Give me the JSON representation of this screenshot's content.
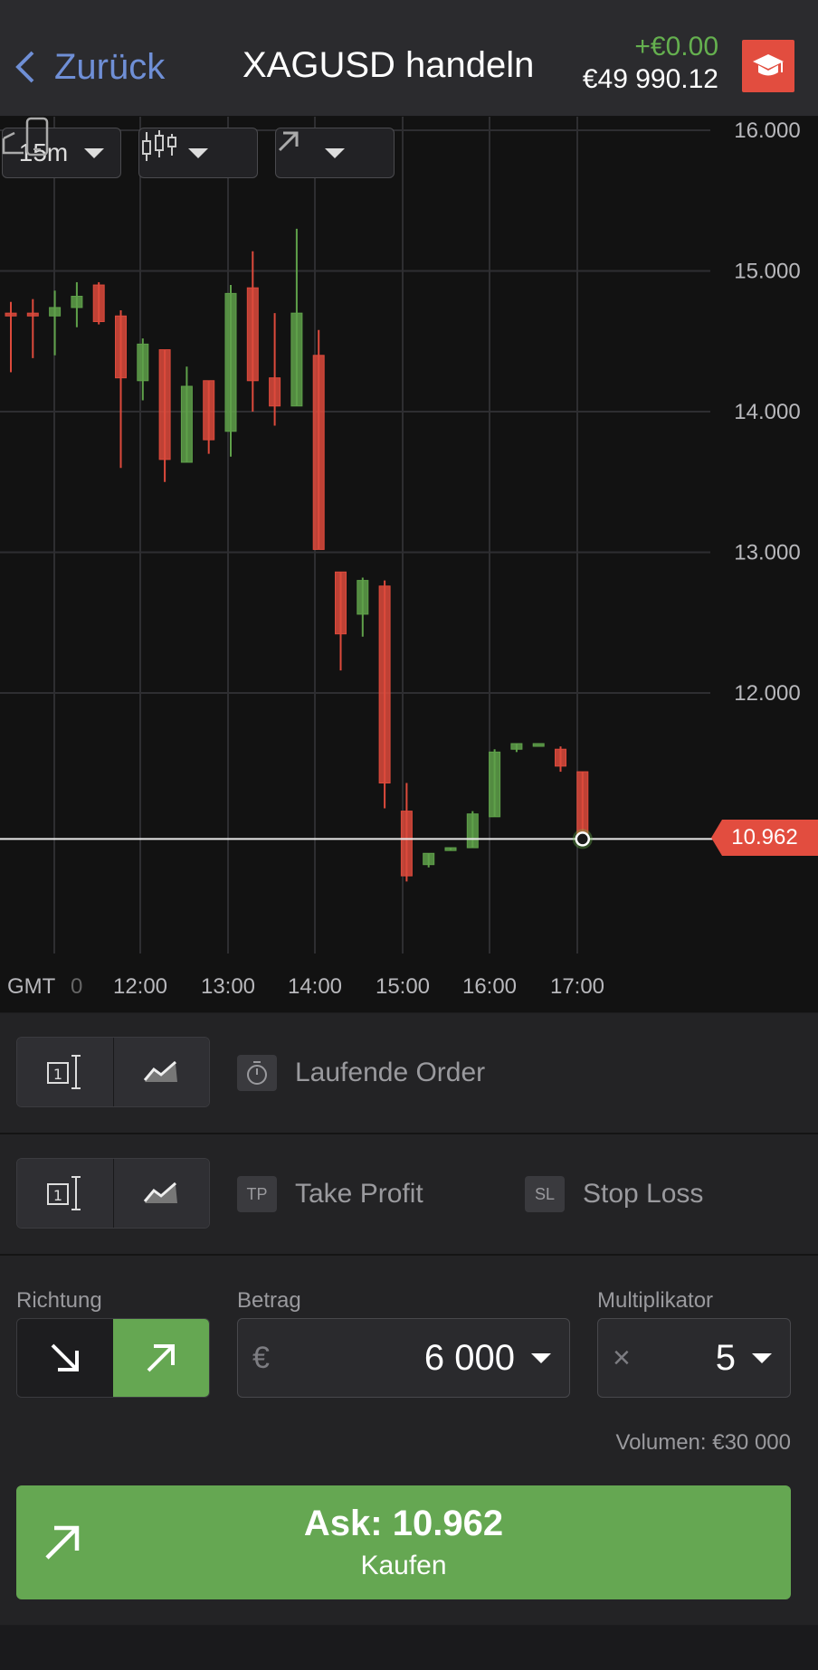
{
  "header": {
    "back_label": "Zurück",
    "title": "XAGUSD handeln",
    "pnl": "+€0.00",
    "balance": "€49 990.12"
  },
  "chart_toolbar": {
    "timeframe": "15m"
  },
  "chart_data": {
    "type": "candlestick",
    "y_ticks": [
      "16.000",
      "15.000",
      "14.000",
      "13.000",
      "12.000"
    ],
    "x_ticks": [
      "12:00",
      "13:00",
      "14:00",
      "15:00",
      "16:00",
      "17:00"
    ],
    "timezone_label": "GMT",
    "timezone_offset": "0",
    "ylim": [
      10.2,
      16.1
    ],
    "current_price": "10.962",
    "current_price_value": 10.962,
    "colors": {
      "up": "#5fa14a",
      "down": "#dd4a3c"
    },
    "candles": [
      {
        "o": 14.7,
        "h": 14.78,
        "l": 14.28,
        "c": 14.68
      },
      {
        "o": 14.7,
        "h": 14.8,
        "l": 14.38,
        "c": 14.68
      },
      {
        "o": 14.68,
        "h": 14.86,
        "l": 14.4,
        "c": 14.74
      },
      {
        "o": 14.74,
        "h": 14.92,
        "l": 14.6,
        "c": 14.82
      },
      {
        "o": 14.9,
        "h": 14.92,
        "l": 14.62,
        "c": 14.64
      },
      {
        "o": 14.68,
        "h": 14.72,
        "l": 13.6,
        "c": 14.24
      },
      {
        "o": 14.22,
        "h": 14.52,
        "l": 14.08,
        "c": 14.48
      },
      {
        "o": 14.44,
        "h": 14.44,
        "l": 13.5,
        "c": 13.66
      },
      {
        "o": 13.64,
        "h": 14.32,
        "l": 13.64,
        "c": 14.18
      },
      {
        "o": 14.22,
        "h": 14.22,
        "l": 13.7,
        "c": 13.8
      },
      {
        "o": 13.86,
        "h": 14.9,
        "l": 13.68,
        "c": 14.84
      },
      {
        "o": 14.88,
        "h": 15.14,
        "l": 14.0,
        "c": 14.22
      },
      {
        "o": 14.24,
        "h": 14.7,
        "l": 13.9,
        "c": 14.04
      },
      {
        "o": 14.04,
        "h": 15.3,
        "l": 14.04,
        "c": 14.7
      },
      {
        "o": 14.4,
        "h": 14.58,
        "l": 13.02,
        "c": 13.02
      },
      {
        "o": 12.86,
        "h": 12.86,
        "l": 12.16,
        "c": 12.42
      },
      {
        "o": 12.56,
        "h": 12.82,
        "l": 12.4,
        "c": 12.8
      },
      {
        "o": 12.76,
        "h": 12.8,
        "l": 11.18,
        "c": 11.36
      },
      {
        "o": 11.16,
        "h": 11.36,
        "l": 10.66,
        "c": 10.7
      },
      {
        "o": 10.78,
        "h": 10.86,
        "l": 10.76,
        "c": 10.86
      },
      {
        "o": 10.88,
        "h": 10.9,
        "l": 10.88,
        "c": 10.9
      },
      {
        "o": 10.9,
        "h": 11.16,
        "l": 10.9,
        "c": 11.14
      },
      {
        "o": 11.12,
        "h": 11.6,
        "l": 11.12,
        "c": 11.58
      },
      {
        "o": 11.6,
        "h": 11.64,
        "l": 11.58,
        "c": 11.64
      },
      {
        "o": 11.64,
        "h": 11.64,
        "l": 11.64,
        "c": 11.64
      },
      {
        "o": 11.6,
        "h": 11.62,
        "l": 11.44,
        "c": 11.48
      },
      {
        "o": 11.44,
        "h": 11.44,
        "l": 10.92,
        "c": 10.962
      }
    ]
  },
  "pending_row": {
    "label": "Laufende Order"
  },
  "tp_sl_row": {
    "tp_badge": "TP",
    "tp_label": "Take Profit",
    "sl_badge": "SL",
    "sl_label": "Stop Loss"
  },
  "trade": {
    "direction_label": "Richtung",
    "amount_label": "Betrag",
    "amount_currency": "€",
    "amount_value": "6 000",
    "multiplier_label": "Multiplikator",
    "multiplier_prefix": "×",
    "multiplier_value": "5",
    "volume": "Volumen: €30 000",
    "buy_price": "Ask: 10.962",
    "buy_label": "Kaufen"
  }
}
